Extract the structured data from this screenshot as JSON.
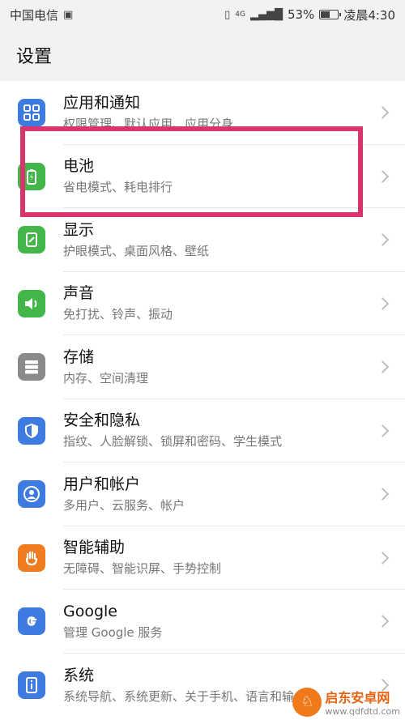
{
  "status_bar": {
    "carrier": "中国电信",
    "battery_percent": "53%",
    "time": "凌晨4:30",
    "network": "4G"
  },
  "page": {
    "title": "设置"
  },
  "settings": [
    {
      "title": "应用和通知",
      "subtitle": "权限管理、默认应用、应用分身",
      "icon": "apps-icon",
      "color": "#3d7be0"
    },
    {
      "title": "电池",
      "subtitle": "省电模式、耗电排行",
      "icon": "battery-icon",
      "color": "#43b649"
    },
    {
      "title": "显示",
      "subtitle": "护眼模式、桌面风格、壁纸",
      "icon": "display-icon",
      "color": "#43b649"
    },
    {
      "title": "声音",
      "subtitle": "免打扰、铃声、振动",
      "icon": "speaker-icon",
      "color": "#43b649"
    },
    {
      "title": "存储",
      "subtitle": "内存、空间清理",
      "icon": "storage-icon",
      "color": "#8a8a8a"
    },
    {
      "title": "安全和隐私",
      "subtitle": "指纹、人脸解锁、锁屏和密码、学生模式",
      "icon": "shield-icon",
      "color": "#3d7be0"
    },
    {
      "title": "用户和帐户",
      "subtitle": "多用户、云服务、帐户",
      "icon": "user-icon",
      "color": "#3d7be0"
    },
    {
      "title": "智能辅助",
      "subtitle": "无障碍、智能识屏、手势控制",
      "icon": "hand-icon",
      "color": "#ef7c1e"
    },
    {
      "title": "Google",
      "subtitle": "管理 Google 服务",
      "icon": "google-icon",
      "color": "#3d7be0"
    },
    {
      "title": "系统",
      "subtitle": "系统导航、系统更新、关于手机、语言和输入法",
      "icon": "system-info-icon",
      "color": "#3d7be0"
    }
  ],
  "watermark": {
    "name": "启东安卓网",
    "url": "www.qdfdtd.com"
  }
}
